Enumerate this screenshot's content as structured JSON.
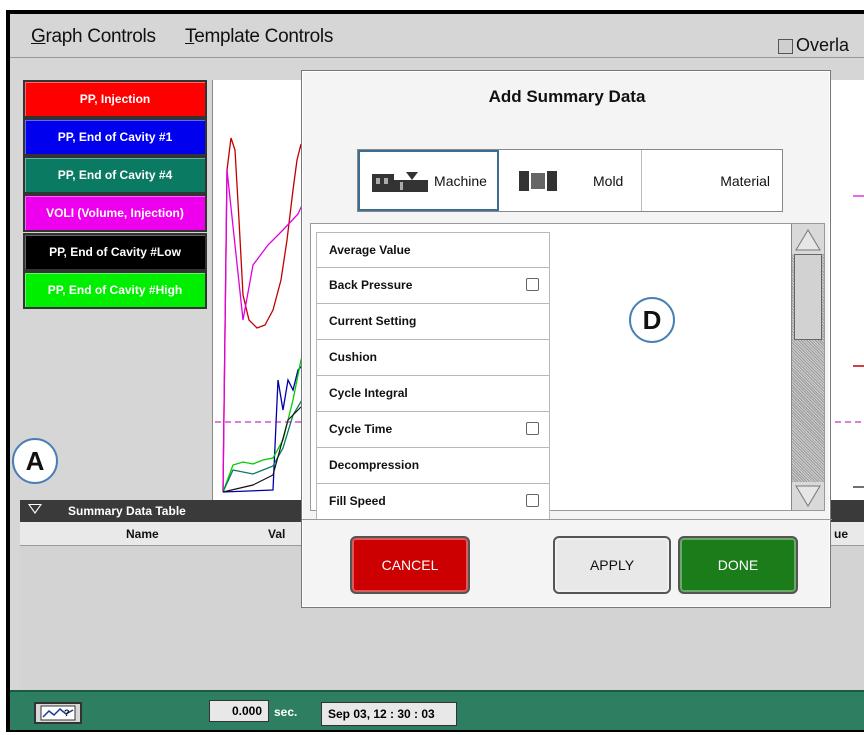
{
  "menu": {
    "graph_controls_first": "G",
    "graph_controls_rest": "raph Controls",
    "template_controls_first": "T",
    "template_controls_rest": "emplate Controls",
    "overlay_label": "Overla"
  },
  "legend": [
    {
      "label": "PP, Injection",
      "color": "#ff0000"
    },
    {
      "label": "PP, End of Cavity #1",
      "color": "#0000ee"
    },
    {
      "label": "PP, End of Cavity #4",
      "color": "#0b7a63"
    },
    {
      "label": "VOLI (Volume, Injection)",
      "color": "#ee00ee"
    },
    {
      "label": "PP, End of Cavity #Low",
      "color": "#000000"
    },
    {
      "label": "PP, End of Cavity #High",
      "color": "#00ee00"
    }
  ],
  "markers": {
    "a": "A",
    "d": "D"
  },
  "summary_table": {
    "title": "Summary Data Table",
    "columns": {
      "name": "Name",
      "value": "Val",
      "value_right": "ue"
    }
  },
  "status": {
    "time_value": "0.000",
    "time_unit": "sec.",
    "date": "Sep 03, 12 : 30 : 03"
  },
  "dialog": {
    "title": "Add Summary Data",
    "tabs": {
      "machine": "Machine",
      "mold": "Mold",
      "material": "Material"
    },
    "items": [
      {
        "label": "Average Value",
        "checkbox": false
      },
      {
        "label": "Back Pressure",
        "checkbox": true
      },
      {
        "label": "Current Setting",
        "checkbox": false
      },
      {
        "label": "Cushion",
        "checkbox": false
      },
      {
        "label": "Cycle Integral",
        "checkbox": false
      },
      {
        "label": "Cycle Time",
        "checkbox": true
      },
      {
        "label": "Decompression",
        "checkbox": false
      },
      {
        "label": "Fill Speed",
        "checkbox": true
      }
    ],
    "buttons": {
      "cancel": "CANCEL",
      "apply": "APPLY",
      "done": "DONE"
    }
  }
}
